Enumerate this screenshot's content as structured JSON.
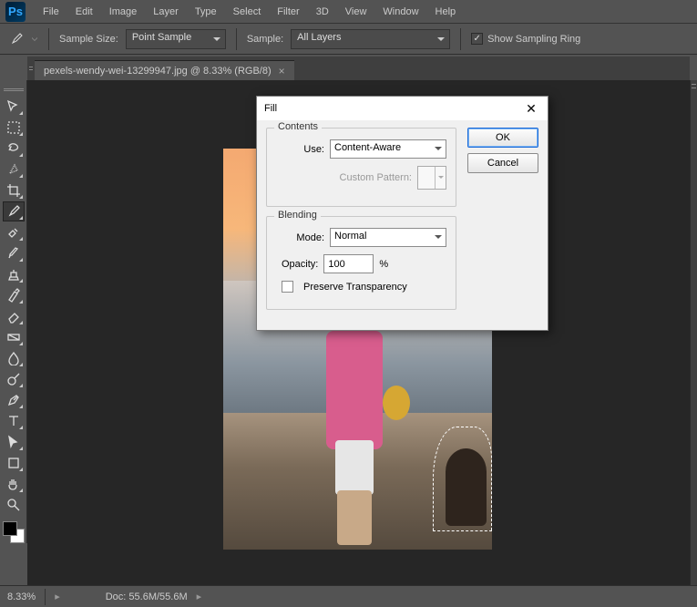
{
  "app": {
    "logo_text": "Ps"
  },
  "menu": {
    "file": "File",
    "edit": "Edit",
    "image": "Image",
    "layer": "Layer",
    "type": "Type",
    "select": "Select",
    "filter": "Filter",
    "threeD": "3D",
    "view": "View",
    "window": "Window",
    "help": "Help"
  },
  "options": {
    "sample_size_label": "Sample Size:",
    "sample_size_value": "Point Sample",
    "sample_label": "Sample:",
    "sample_value": "All Layers",
    "show_sampling_ring": "Show Sampling Ring",
    "checked_glyph": "✓"
  },
  "document": {
    "tab_title": "pexels-wendy-wei-13299947.jpg @ 8.33% (RGB/8)",
    "close_glyph": "×"
  },
  "status": {
    "zoom": "8.33%",
    "doc_label": "Doc:",
    "doc_value": "55.6M/55.6M",
    "arrow": "▸"
  },
  "dialog": {
    "title": "Fill",
    "close_glyph": "✕",
    "ok": "OK",
    "cancel": "Cancel",
    "contents": {
      "legend": "Contents",
      "use_label": "Use:",
      "use_value": "Content-Aware",
      "custom_pattern_label": "Custom Pattern:"
    },
    "blending": {
      "legend": "Blending",
      "mode_label": "Mode:",
      "mode_value": "Normal",
      "opacity_label": "Opacity:",
      "opacity_value": "100",
      "opacity_unit": "%",
      "preserve_transparency": "Preserve Transparency"
    }
  },
  "tools": {
    "move": "move",
    "marquee": "marquee",
    "lasso": "lasso",
    "quick-select": "quick-select",
    "crop": "crop",
    "eyedropper": "eyedropper",
    "healing": "healing",
    "brush": "brush",
    "stamp": "stamp",
    "history": "history",
    "eraser": "eraser",
    "gradient": "gradient",
    "blur": "blur",
    "dodge": "dodge",
    "pen": "pen",
    "type": "type",
    "path": "path",
    "shape": "shape",
    "hand": "hand",
    "zoom": "zoom"
  }
}
